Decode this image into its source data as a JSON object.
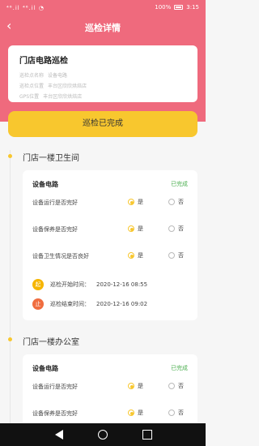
{
  "status_bar": {
    "left": "⁴⁶.il ⁴⁶.il ◔",
    "battery_percent": "100%",
    "time": "3:15"
  },
  "nav": {
    "title": "巡检详情"
  },
  "task": {
    "name": "门店电路巡检",
    "rows": [
      {
        "label": "巡检点名称",
        "value": "设备电路"
      },
      {
        "label": "巡检点位置",
        "value": "丰台区欣欣烘焙店"
      },
      {
        "label": "GPS位置",
        "value": "丰台区欣欣烘焙店"
      }
    ],
    "status_button": "巡检已完成"
  },
  "sections": [
    {
      "title": "门店一楼卫生间",
      "card": {
        "head": "设备电路",
        "status": "已完成",
        "questions": [
          {
            "label": "设备运行是否完好",
            "yes": "是",
            "no": "否"
          },
          {
            "label": "设备保养是否完好",
            "yes": "是",
            "no": "否"
          },
          {
            "label": "设备卫生情况是否良好",
            "yes": "是",
            "no": "否"
          }
        ],
        "start_badge": "起",
        "start_text": "巡检开始时间：",
        "start_time": "2020-12-16 08:55",
        "end_badge": "止",
        "end_text": "巡检结束时间：",
        "end_time": "2020-12-16 09:02"
      }
    },
    {
      "title": "门店一楼办公室",
      "card": {
        "head": "设备电路",
        "status": "已完成",
        "questions": [
          {
            "label": "设备运行是否完好",
            "yes": "是",
            "no": "否"
          },
          {
            "label": "设备保养是否完好",
            "yes": "是",
            "no": "否"
          }
        ]
      }
    }
  ],
  "colors": {
    "header": "#ef6a7d",
    "accent": "#f8c72e",
    "done": "#4caf50"
  }
}
